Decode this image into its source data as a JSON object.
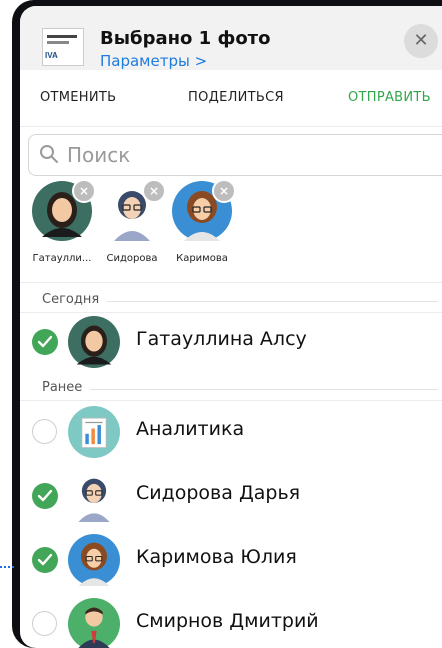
{
  "header": {
    "title": "Выбрано 1 фото",
    "subtitle": "Параметры >",
    "thumb_logo": "IVA",
    "close_glyph": "✕"
  },
  "actions": {
    "cancel": "ОТМЕНИТЬ",
    "share": "ПОДЕЛИТЬСЯ",
    "send": "ОТПРАВИТЬ"
  },
  "search": {
    "placeholder": "Поиск"
  },
  "selected": [
    {
      "label": "Гатаулли...",
      "avatar": "woman-dark-hair"
    },
    {
      "label": "Сидорова",
      "avatar": "woman-glasses"
    },
    {
      "label": "Каримова",
      "avatar": "woman-glasses-blue"
    }
  ],
  "sections": {
    "today": "Сегодня",
    "earlier": "Ранее"
  },
  "contacts_today": [
    {
      "name": "Гатауллина Алсу",
      "checked": true
    }
  ],
  "contacts_earlier": [
    {
      "name": "Аналитика",
      "checked": false
    },
    {
      "name": "Сидорова Дарья",
      "checked": true
    },
    {
      "name": "Каримова Юлия",
      "checked": true
    },
    {
      "name": "Смирнов Дмитрий",
      "checked": false
    }
  ],
  "colors": {
    "accent_green": "#41a657",
    "link_blue": "#1e7be0"
  }
}
